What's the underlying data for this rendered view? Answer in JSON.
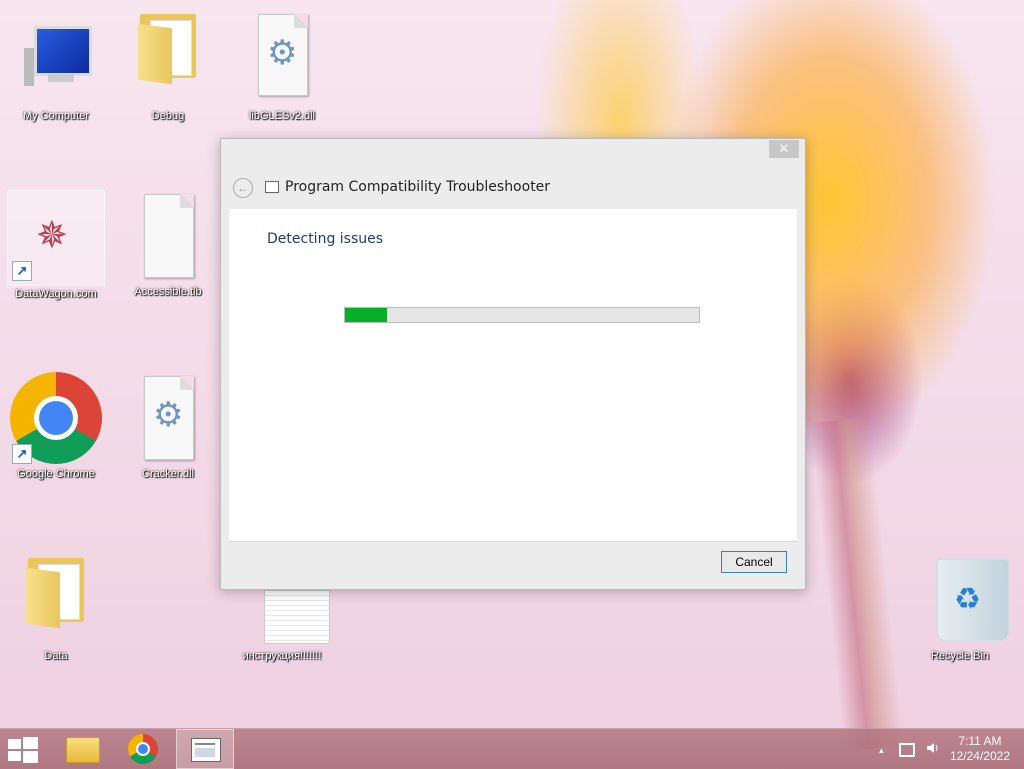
{
  "desktop_icons": [
    {
      "label": "My Computer"
    },
    {
      "label": "Debug"
    },
    {
      "label": "libGLESv2.dll"
    },
    {
      "label": "DataWagon.com"
    },
    {
      "label": "Accessible.tlb"
    },
    {
      "label": "Google Chrome"
    },
    {
      "label": "Cracker.dll"
    },
    {
      "label": "Data"
    },
    {
      "label": "инструкция!!!!!!!"
    },
    {
      "label": "Recycle Bin"
    }
  ],
  "dialog": {
    "title": "Program Compatibility Troubleshooter",
    "heading": "Detecting issues",
    "progress": 0.12,
    "cancel_label": "Cancel",
    "close_glyph": "✕",
    "back_glyph": "←"
  },
  "taskbar": {
    "time": "7:11 AM",
    "date": "12/24/2022",
    "tray_up_glyph": "▲"
  },
  "colors": {
    "progress_fill": "#06b025",
    "heading": "#1e3c78"
  }
}
